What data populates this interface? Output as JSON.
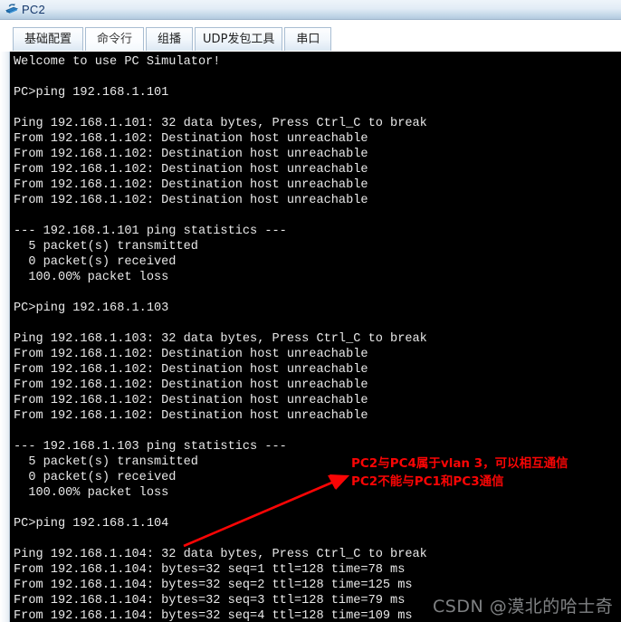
{
  "window": {
    "title": "PC2",
    "icon": "pc-device-icon"
  },
  "tabs": [
    {
      "label": "基础配置",
      "active": false
    },
    {
      "label": "命令行",
      "active": true
    },
    {
      "label": "组播",
      "active": false
    },
    {
      "label": "UDP发包工具",
      "active": false
    },
    {
      "label": "串口",
      "active": false
    }
  ],
  "terminal": {
    "lines": [
      "Welcome to use PC Simulator!",
      "",
      "PC>ping 192.168.1.101",
      "",
      "Ping 192.168.1.101: 32 data bytes, Press Ctrl_C to break",
      "From 192.168.1.102: Destination host unreachable",
      "From 192.168.1.102: Destination host unreachable",
      "From 192.168.1.102: Destination host unreachable",
      "From 192.168.1.102: Destination host unreachable",
      "From 192.168.1.102: Destination host unreachable",
      "",
      "--- 192.168.1.101 ping statistics ---",
      "  5 packet(s) transmitted",
      "  0 packet(s) received",
      "  100.00% packet loss",
      "",
      "PC>ping 192.168.1.103",
      "",
      "Ping 192.168.1.103: 32 data bytes, Press Ctrl_C to break",
      "From 192.168.1.102: Destination host unreachable",
      "From 192.168.1.102: Destination host unreachable",
      "From 192.168.1.102: Destination host unreachable",
      "From 192.168.1.102: Destination host unreachable",
      "From 192.168.1.102: Destination host unreachable",
      "",
      "--- 192.168.1.103 ping statistics ---",
      "  5 packet(s) transmitted",
      "  0 packet(s) received",
      "  100.00% packet loss",
      "",
      "PC>ping 192.168.1.104",
      "",
      "Ping 192.168.1.104: 32 data bytes, Press Ctrl_C to break",
      "From 192.168.1.104: bytes=32 seq=1 ttl=128 time=78 ms",
      "From 192.168.1.104: bytes=32 seq=2 ttl=128 time=125 ms",
      "From 192.168.1.104: bytes=32 seq=3 ttl=128 time=79 ms",
      "From 192.168.1.104: bytes=32 seq=4 ttl=128 time=109 ms"
    ]
  },
  "annotation": {
    "line1": "PC2与PC4属于vlan 3，可以相互通信",
    "line2": "PC2不能与PC1和PC3通信",
    "color": "#fa0505",
    "arrow": "red-arrow-icon"
  },
  "watermark": {
    "text": "CSDN @漠北的哈士奇"
  }
}
